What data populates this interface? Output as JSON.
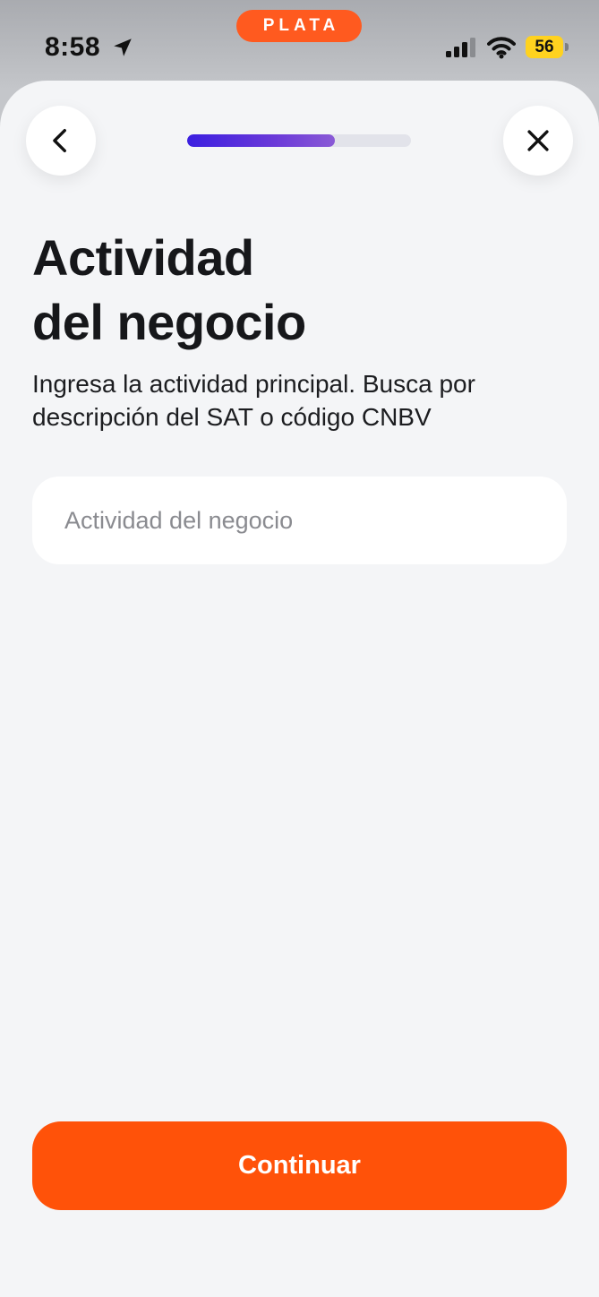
{
  "status_bar": {
    "time": "8:58",
    "brand": "PLATA",
    "battery": "56"
  },
  "progress": {
    "fraction": 0.66
  },
  "page": {
    "title_line1": "Actividad",
    "title_line2": "del negocio",
    "subtitle": "Ingresa la actividad principal. Busca por descripción del SAT o código CNBV"
  },
  "form": {
    "activity_placeholder": "Actividad del negocio",
    "activity_value": ""
  },
  "actions": {
    "continue_label": "Continuar"
  },
  "colors": {
    "brand_orange": "#ff5209",
    "progress_start": "#3b1fe0",
    "progress_end": "#8a5ad6",
    "battery_yellow": "#ffd21f"
  },
  "icons": {
    "back": "chevron-left-icon",
    "close": "close-icon",
    "location": "location-arrow-icon",
    "signal": "signal-icon",
    "wifi": "wifi-icon"
  }
}
